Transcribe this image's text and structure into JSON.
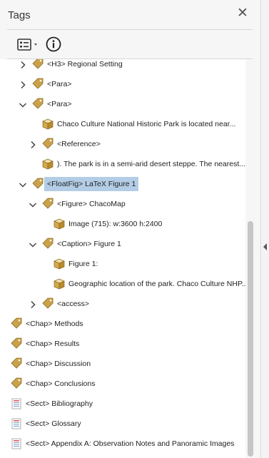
{
  "panel": {
    "title": "Tags"
  },
  "toolbar": {
    "options_icon": "options-list-icon",
    "info_icon": "info-icon"
  },
  "tree": {
    "rows": [
      {
        "label": "<H3> Regional Setting",
        "icon": "tag-icon",
        "expanded": false,
        "depth": 0
      },
      {
        "label": "<Para>",
        "icon": "tag-icon",
        "expanded": false,
        "depth": 0
      },
      {
        "label": "<Para>",
        "icon": "tag-icon",
        "expanded": true,
        "depth": 0
      },
      {
        "label": "Chaco Culture National Historic Park is located near...",
        "icon": "content-icon",
        "depth": 1
      },
      {
        "label": "<Reference>",
        "icon": "tag-icon",
        "expanded": false,
        "depth": 1
      },
      {
        "label": "). The park is in a semi-arid desert steppe. The nearest...",
        "icon": "content-icon",
        "depth": 1
      },
      {
        "label": "<FloatFig> LaTeX Figure 1",
        "icon": "tag-icon",
        "expanded": true,
        "depth": 0,
        "selected": true
      },
      {
        "label": "<Figure> ChacoMap",
        "icon": "tag-icon",
        "expanded": true,
        "depth": 1
      },
      {
        "label": "Image (715): w:3600 h:2400",
        "icon": "content-icon",
        "depth": 2
      },
      {
        "label": "<Caption> Figure 1",
        "icon": "tag-icon",
        "expanded": true,
        "depth": 1
      },
      {
        "label": "Figure 1:",
        "icon": "content-icon",
        "depth": 2
      },
      {
        "label": "Geographic location of the park. Chaco Culture NHP...",
        "icon": "content-icon",
        "depth": 2
      },
      {
        "label": "<access>",
        "icon": "tag-icon",
        "expanded": false,
        "depth": 1
      },
      {
        "label": "<Chap> Methods",
        "icon": "tag-icon",
        "depth": -1
      },
      {
        "label": "<Chap> Results",
        "icon": "tag-icon",
        "depth": -1
      },
      {
        "label": "<Chap> Discussion",
        "icon": "tag-icon",
        "depth": -1
      },
      {
        "label": "<Chap> Conclusions",
        "icon": "tag-icon",
        "depth": -1
      },
      {
        "label": "<Sect> Bibliography",
        "icon": "sect-icon",
        "depth": -1
      },
      {
        "label": "<Sect> Glossary",
        "icon": "sect-icon",
        "depth": -1
      },
      {
        "label": "<Sect> Appendix A: Observation Notes and Panoramic Images",
        "icon": "sect-icon",
        "depth": -1
      }
    ]
  },
  "colors": {
    "selection": "#b3cde6",
    "tag": "#c9a24a",
    "sect": "#d9534f"
  }
}
